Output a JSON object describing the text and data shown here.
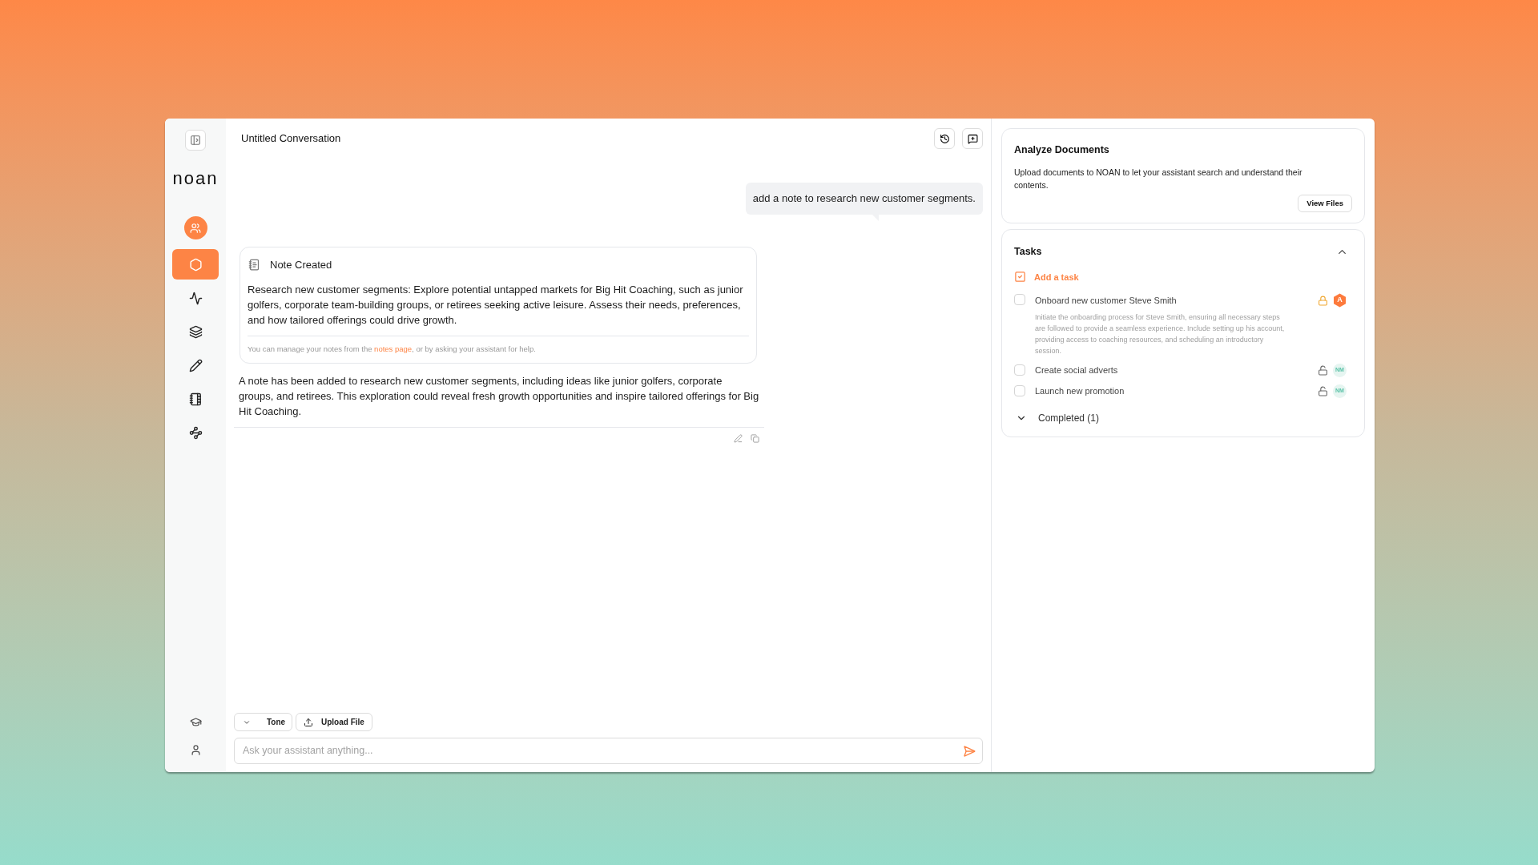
{
  "sidebar": {
    "brand": "noan",
    "nav": [
      {
        "kind": "hexagon",
        "selected": true
      },
      {
        "kind": "activity",
        "selected": false
      },
      {
        "kind": "layers",
        "selected": false
      },
      {
        "kind": "pencil",
        "selected": false
      },
      {
        "kind": "notebook",
        "selected": false
      },
      {
        "kind": "nodes",
        "selected": false
      }
    ],
    "bottom": [
      {
        "kind": "academy"
      },
      {
        "kind": "user"
      }
    ]
  },
  "chat": {
    "title": "Untitled Conversation",
    "messages": [
      {
        "kind": "user",
        "text": "add a note to research new customer segments."
      },
      {
        "kind": "note",
        "title": "Note Created",
        "body": "Research new customer segments: Explore potential untapped markets for Big Hit Coaching, such as junior golfers, corporate team-building groups, or retirees seeking active leisure. Assess their needs, preferences, and how tailored offerings could drive growth.",
        "footer_before": "You can manage your notes from the",
        "footer_link": "notes page",
        "footer_after": ", or by asking your assistant for help."
      },
      {
        "kind": "assistant",
        "text": "A note has been added to research new customer segments, including ideas like junior golfers, corporate groups, and retirees. This exploration could reveal fresh growth opportunities and inspire tailored offerings for Big Hit Coaching."
      }
    ],
    "tools": [
      {
        "kind": "dropdown",
        "label": "Tone"
      },
      {
        "kind": "upload",
        "label": "Upload File"
      }
    ],
    "input": {
      "placeholder": "Ask your assistant anything..."
    }
  },
  "documents": {
    "title": "Analyze Documents",
    "text": "Upload documents to NOAN to let your assistant search and understand their contents.",
    "button": "View Files"
  },
  "tasks": {
    "title": "Tasks",
    "expanded": true,
    "add_label": "Add a task",
    "items": [
      {
        "title": "Onboard new customer Steve Smith",
        "checked": false,
        "locked": true,
        "assignee": {
          "kind": "agent",
          "initials": "A"
        },
        "description": "Initiate the onboarding process for Steve Smith, ensuring all necessary steps are followed to provide a seamless experience. Include setting up his account, providing access to coaching resources, and scheduling an introductory session."
      },
      {
        "title": "Create social adverts",
        "checked": false,
        "locked": false,
        "assignee": {
          "kind": "person",
          "initials": "NM"
        }
      },
      {
        "title": "Launch new promotion",
        "checked": false,
        "locked": false,
        "assignee": {
          "kind": "person",
          "initials": "NM"
        }
      }
    ],
    "completed": {
      "label": "Completed (1)",
      "expanded": false
    }
  }
}
